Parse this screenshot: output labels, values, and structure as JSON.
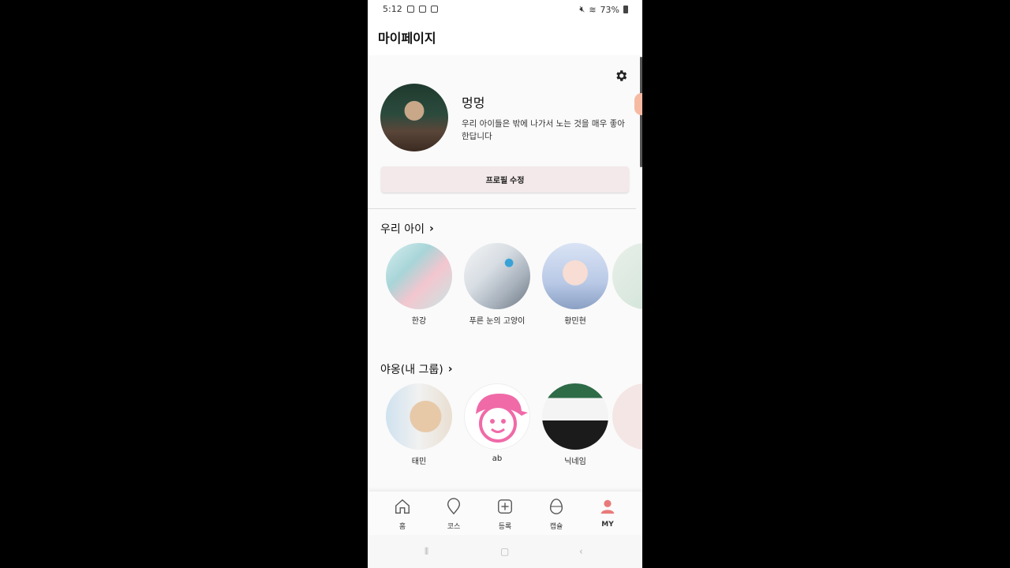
{
  "status_bar": {
    "time": "5:12",
    "battery": "73%"
  },
  "header": {
    "title": "마이페이지"
  },
  "profile": {
    "name": "멍멍",
    "bio": "우리 아이들은 밖에 나가서 노는 것을 매우 좋아한답니다",
    "edit_button": "프로필 수정"
  },
  "pets_section": {
    "title": "우리 아이",
    "items": [
      {
        "label": "한강"
      },
      {
        "label": "푸른 눈의 고양이"
      },
      {
        "label": "황민현"
      }
    ]
  },
  "group_section": {
    "title": "야옹(내 그룹)",
    "items": [
      {
        "label": "태민"
      },
      {
        "label": "ab"
      },
      {
        "label": "닉네임"
      }
    ]
  },
  "bottom_nav": {
    "items": [
      {
        "label": "홈",
        "icon": "home-icon"
      },
      {
        "label": "코스",
        "icon": "location-pin-icon"
      },
      {
        "label": "등록",
        "icon": "add-square-icon"
      },
      {
        "label": "캡슐",
        "icon": "capsule-egg-icon"
      },
      {
        "label": "MY",
        "icon": "person-icon"
      }
    ],
    "active": "MY",
    "accent_color": "#e97a7a"
  },
  "system_nav": {
    "recent": "⫴",
    "home": "▢",
    "back": "‹"
  }
}
